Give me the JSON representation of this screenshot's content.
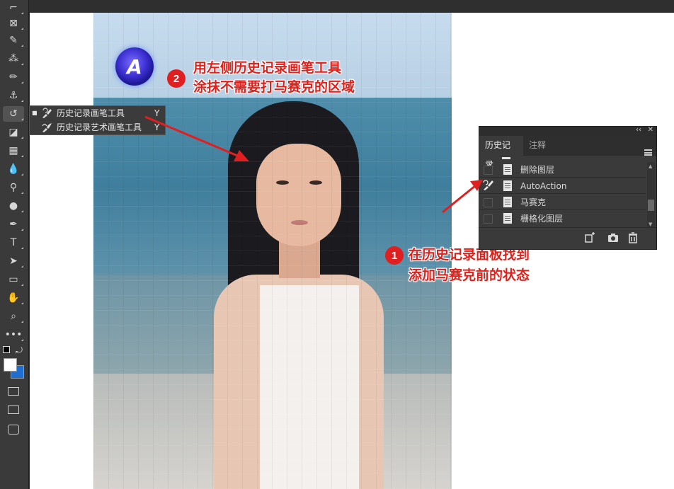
{
  "toolbar": {
    "tools": [
      {
        "name": "crop-tool-icon",
        "glyph": "⌐"
      },
      {
        "name": "frame-tool-icon",
        "glyph": "⊠"
      },
      {
        "name": "eyedropper-tool-icon",
        "glyph": "✎"
      },
      {
        "name": "spot-healing-tool-icon",
        "glyph": "⁂"
      },
      {
        "name": "brush-tool-icon",
        "glyph": "✏"
      },
      {
        "name": "clone-stamp-tool-icon",
        "glyph": "⚓"
      },
      {
        "name": "history-brush-tool-icon",
        "glyph": "↺"
      },
      {
        "name": "eraser-tool-icon",
        "glyph": "◪"
      },
      {
        "name": "gradient-tool-icon",
        "glyph": "▦"
      },
      {
        "name": "blur-tool-icon",
        "glyph": "💧"
      },
      {
        "name": "sponge-tool-icon",
        "glyph": "⚲"
      },
      {
        "name": "dodge-tool-icon",
        "glyph": "●"
      },
      {
        "name": "pen-tool-icon",
        "glyph": "✒"
      },
      {
        "name": "type-tool-icon",
        "glyph": "T"
      },
      {
        "name": "path-selection-tool-icon",
        "glyph": "➤"
      },
      {
        "name": "rectangle-tool-icon",
        "glyph": "▭"
      },
      {
        "name": "hand-tool-icon",
        "glyph": "✋"
      },
      {
        "name": "zoom-tool-icon",
        "glyph": "⌕"
      },
      {
        "name": "more-tools-icon",
        "glyph": "•••"
      }
    ],
    "foreground_color": "#ffffff",
    "background_color": "#1e6fd0"
  },
  "flyout": {
    "items": [
      {
        "label": "历史记录画笔工具",
        "shortcut": "Y",
        "selected": true
      },
      {
        "label": "历史记录艺术画笔工具",
        "shortcut": "Y",
        "selected": false
      }
    ]
  },
  "annotations": {
    "step2": {
      "number": "2",
      "line1": "用左侧历史记录画笔工具",
      "line2": "涂抹不需要打马赛克的区域"
    },
    "step1": {
      "number": "1",
      "line1": "在历史记录面板找到",
      "line2": "添加马赛克前的状态"
    }
  },
  "logo": {
    "letter": "A"
  },
  "history_panel": {
    "collapse_glyph": "‹‹",
    "close_glyph": "✕",
    "tabs": [
      {
        "label": "历史记录",
        "active": true
      },
      {
        "label": "注释",
        "active": false
      }
    ],
    "rows": [
      {
        "label": "删除图层",
        "brush_source": false
      },
      {
        "label": "AutoAction",
        "brush_source": true
      },
      {
        "label": "马赛克",
        "brush_source": false
      },
      {
        "label": "栅格化图层",
        "brush_source": false
      }
    ]
  },
  "colors": {
    "annotation_red": "#e0201a",
    "accent_blue": "#1e6fd0"
  }
}
